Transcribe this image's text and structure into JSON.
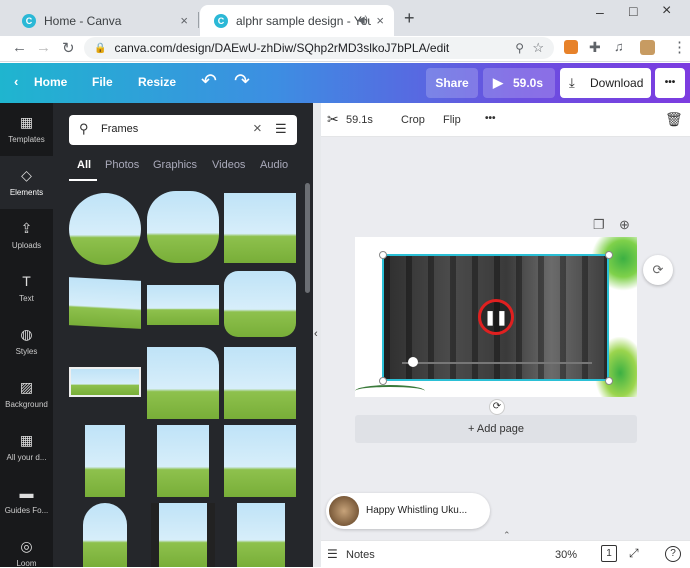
{
  "browser": {
    "tabs": [
      {
        "title": "Home - Canva",
        "close": "×"
      },
      {
        "title": "alphr sample design - YouTu",
        "close": "×"
      }
    ],
    "new_tab": "+",
    "url": "canva.com/design/DAEwU-zhDiw/SQhp2rMD3slkoJ7bPLA/edit",
    "window_controls": [
      "–",
      "□",
      "×"
    ]
  },
  "toolbar": {
    "home": "Home",
    "file": "File",
    "resize": "Resize",
    "undo": "↶",
    "redo": "↷",
    "share": "Share",
    "play_duration": "59.0s",
    "download": "Download",
    "more": "•••"
  },
  "sidebar": {
    "items": [
      {
        "label": "Templates",
        "icon": "▦"
      },
      {
        "label": "Elements",
        "icon": "◇"
      },
      {
        "label": "Uploads",
        "icon": "⇪"
      },
      {
        "label": "Text",
        "icon": "T"
      },
      {
        "label": "Styles",
        "icon": "◍"
      },
      {
        "label": "Background",
        "icon": "▨"
      },
      {
        "label": "All your d...",
        "icon": "▦"
      },
      {
        "label": "Guides Fo...",
        "icon": "▬"
      },
      {
        "label": "Loom",
        "icon": "◎"
      }
    ]
  },
  "panel": {
    "search_value": "Frames",
    "tabs": [
      "All",
      "Photos",
      "Graphics",
      "Videos",
      "Audio"
    ]
  },
  "canvas_toolbar": {
    "duration": "59.1s",
    "crop": "Crop",
    "flip": "Flip",
    "more": "•••"
  },
  "canvas": {
    "add_page": "+ Add page",
    "audio_track": "Happy Whistling Uku..."
  },
  "bottom_bar": {
    "notes": "Notes",
    "zoom": "30%",
    "page_num": "1",
    "help": "?"
  }
}
